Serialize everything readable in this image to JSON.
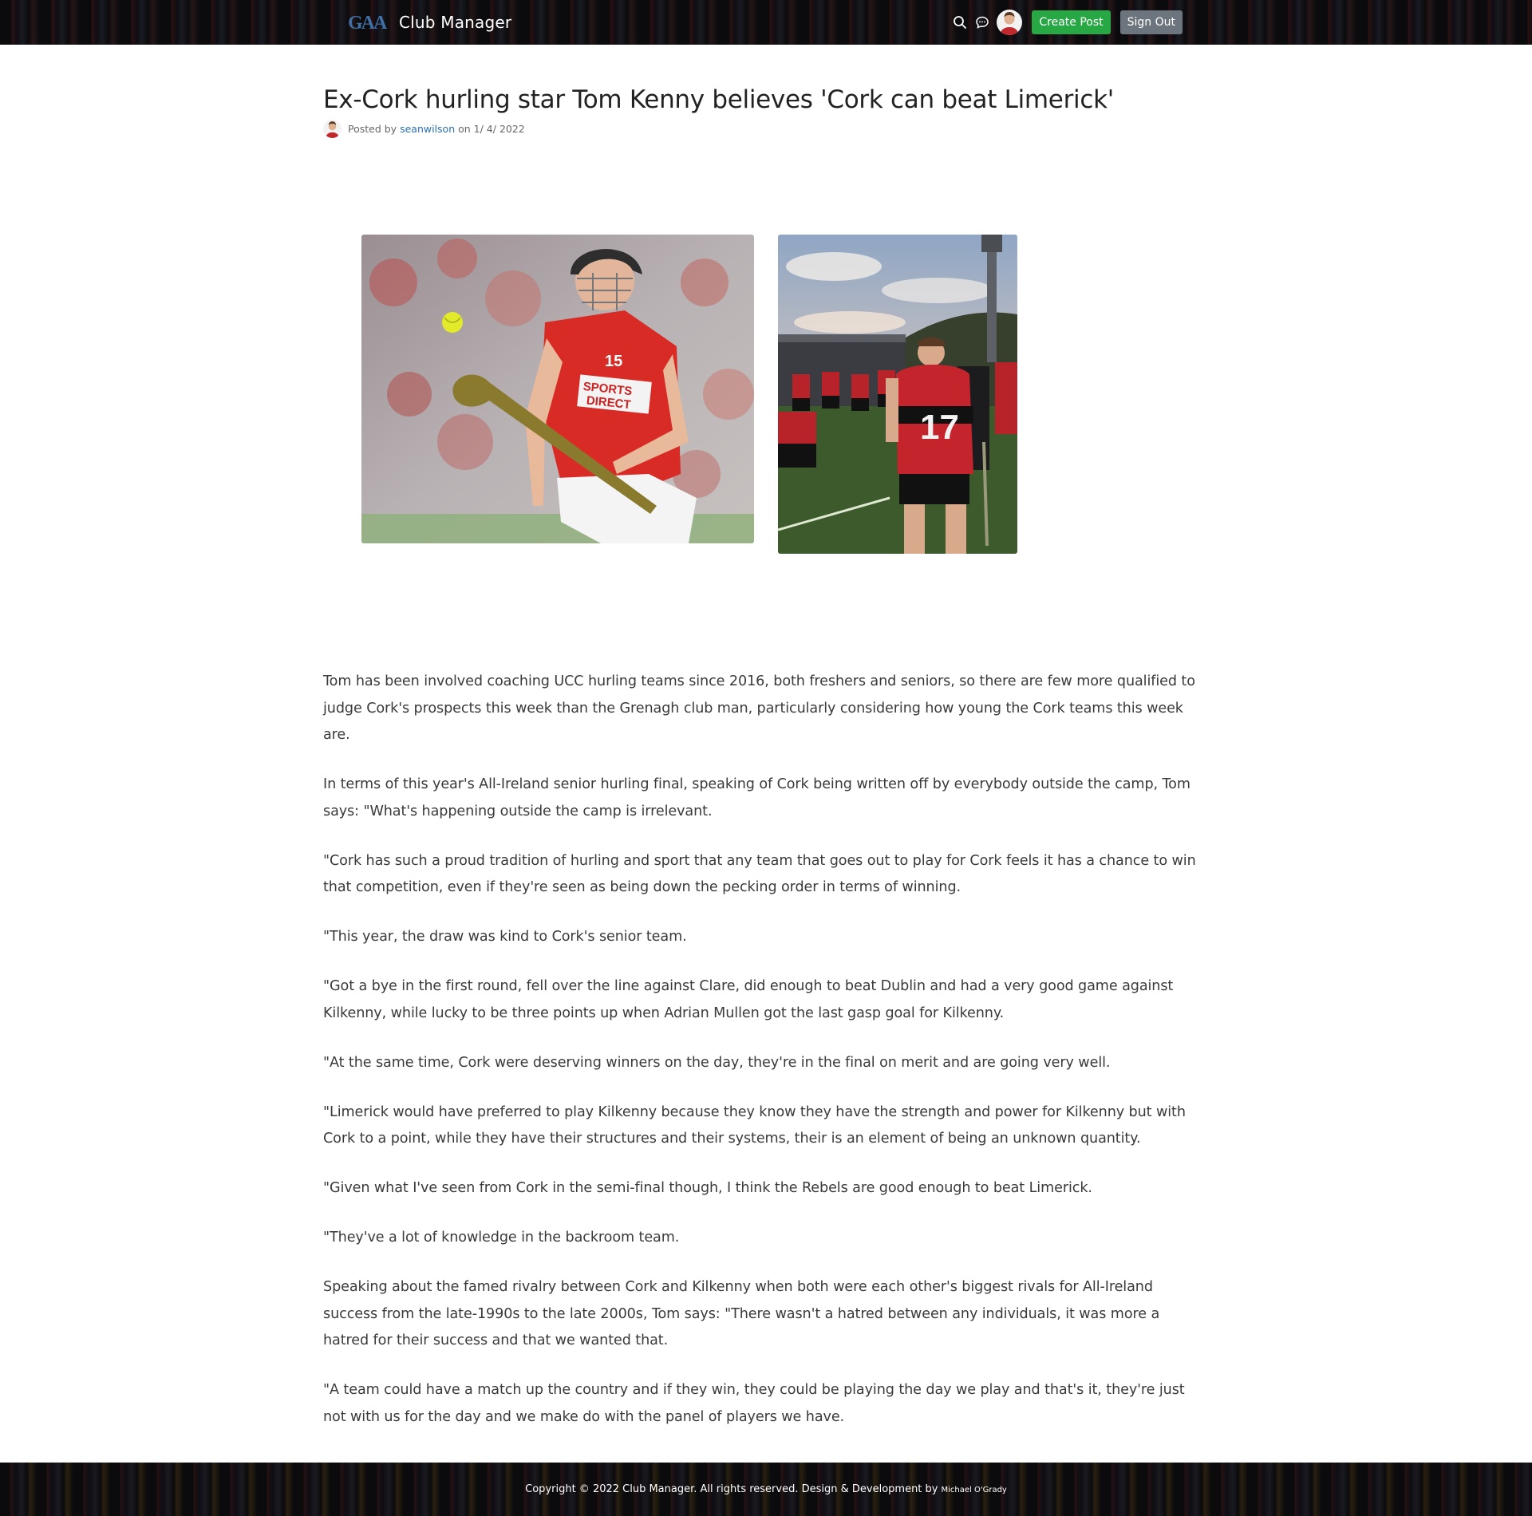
{
  "header": {
    "brand_logo_text": "GAA",
    "brand_name": "Club Manager",
    "search_icon": "search-icon",
    "messages_icon": "chat-bubble-icon",
    "create_post_label": "Create Post",
    "sign_out_label": "Sign Out"
  },
  "article": {
    "title": "Ex-Cork hurling star Tom Kenny believes 'Cork can beat Limerick'",
    "meta_prefix": "Posted by",
    "author": "seanwilson",
    "meta_on": "on",
    "date": "1/ 4/ 2022",
    "images": [
      {
        "description": "hurler-in-red-jersey-15"
      },
      {
        "description": "players-in-red-and-black-17"
      }
    ],
    "paragraphs": [
      "Tom has been involved coaching UCC hurling teams since 2016, both freshers and seniors, so there are few more qualified to judge Cork's prospects this week than the Grenagh club man, particularly considering how young the Cork teams this week are.",
      "In terms of this year's All-Ireland senior hurling final, speaking of Cork being written off by everybody outside the camp, Tom says: \"What's happening outside the camp is irrelevant.",
      "\"Cork has such a proud tradition of hurling and sport that any team that goes out to play for Cork feels it has a chance to win that competition, even if they're seen as being down the pecking order in terms of winning.",
      "\"This year, the draw was kind to Cork's senior team.",
      "\"Got a bye in the first round, fell over the line against Clare, did enough to beat Dublin and had a very good game against Kilkenny, while lucky to be three points up when Adrian Mullen got the last gasp goal for Kilkenny.",
      "\"At the same time, Cork were deserving winners on the day, they're in the final on merit and are going very well.",
      "\"Limerick would have preferred to play Kilkenny because they know they have the strength and power for Kilkenny but with Cork to a point, while they have their structures and their systems, their is an element of being an unknown quantity.",
      "\"Given what I've seen from Cork in the semi-final though, I think the Rebels are good enough to beat Limerick.",
      "\"They've a lot of knowledge in the backroom team.",
      "Speaking about the famed rivalry between Cork and Kilkenny when both were each other's biggest rivals for All-Ireland success from the late-1990s to the late 2000s, Tom says: \"There wasn't a hatred between any individuals, it was more a hatred for their success and that we wanted that.",
      "\"A team could have a match up the country and if they win, they could be playing the day we play and that's it, they're just not with us for the day and we make do with the panel of players we have."
    ]
  },
  "footer": {
    "copyright": "Copyright © 2022 Club Manager. All rights reserved. Design & Development by",
    "author": "Michael O'Grady"
  },
  "colors": {
    "success": "#28a745",
    "secondary": "#6c757d",
    "link": "#2a6fb0",
    "header_bg": "#0b0b0d"
  }
}
